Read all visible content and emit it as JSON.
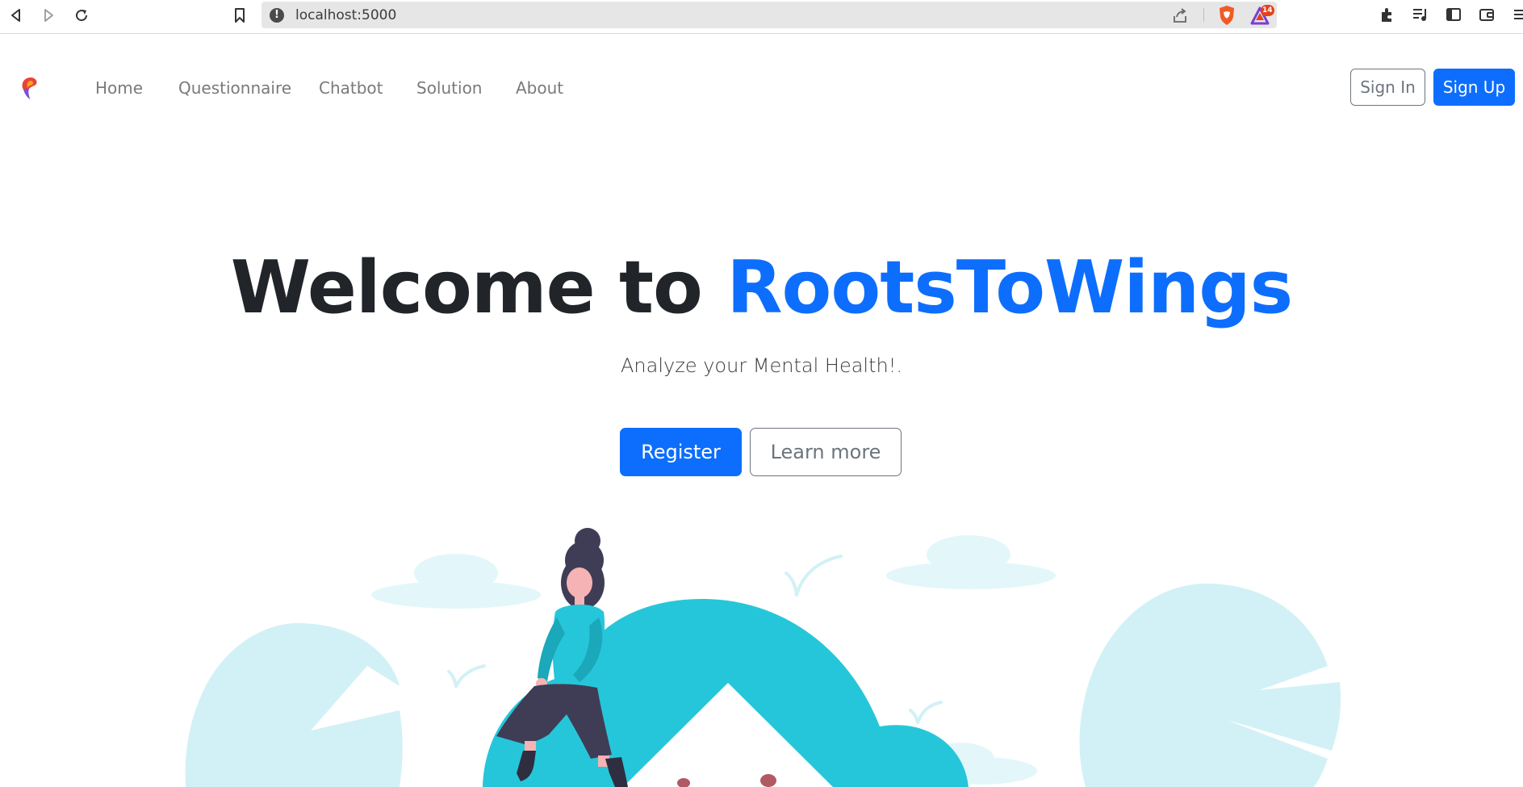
{
  "browser": {
    "url": "localhost:5000",
    "rewards_badge": "14"
  },
  "navbar": {
    "links": [
      "Home",
      "Questionnaire",
      "Chatbot",
      "Solution",
      "About"
    ],
    "signin_label": "Sign In",
    "signup_label": "Sign Up"
  },
  "hero": {
    "title_prefix": "Welcome to ",
    "title_brand": "RootsToWings",
    "subtitle": "Analyze your Mental Health!.",
    "register_label": "Register",
    "learn_more_label": "Learn more"
  },
  "colors": {
    "primary": "#0d6efd",
    "secondary": "#6c757d",
    "illustration_teal": "#26c6da",
    "illustration_light": "#d2f1f6"
  }
}
